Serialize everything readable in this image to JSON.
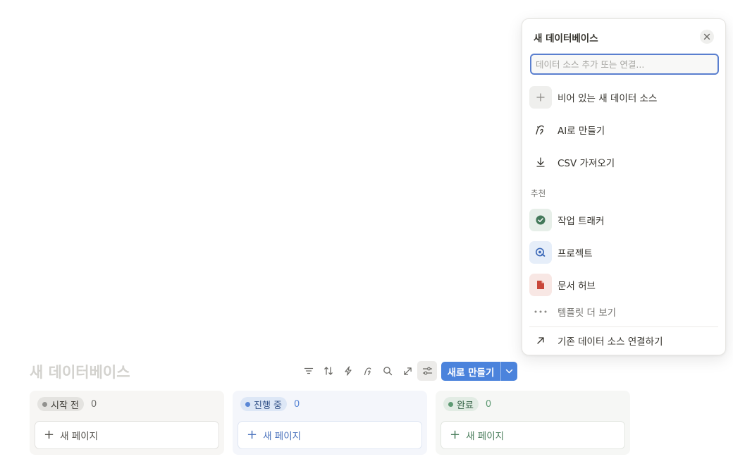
{
  "popup": {
    "title": "새 데이터베이스",
    "search_placeholder": "데이터 소스 추가 또는 연결...",
    "items": {
      "empty": "비어 있는 새 데이터 소스",
      "ai": "AI로 만들기",
      "csv": "CSV 가져오기"
    },
    "recommended_label": "추천",
    "templates": {
      "task": "작업 트래커",
      "project": "프로젝트",
      "docs": "문서 허브"
    },
    "more_templates": "템플릿 더 보기",
    "connect_existing": "기존 데이터 소스 연결하기"
  },
  "database": {
    "title": "새 데이터베이스",
    "new_button": "새로 만들기",
    "columns": [
      {
        "label": "시작 전",
        "count": "0",
        "new_page": "새 페이지"
      },
      {
        "label": "진행 중",
        "count": "0",
        "new_page": "새 페이지"
      },
      {
        "label": "완료",
        "count": "0",
        "new_page": "새 페이지"
      }
    ]
  },
  "icons": {
    "close": "close-icon",
    "plus": "plus-icon",
    "ai": "ai-sparkle-icon",
    "download": "download-icon",
    "check": "check-circle-icon",
    "target": "target-icon",
    "document": "document-icon",
    "ellipsis": "ellipsis-icon",
    "arrow": "arrow-up-right-icon",
    "filter": "filter-icon",
    "sort": "sort-icon",
    "automation": "lightning-icon",
    "search": "search-icon",
    "expand": "expand-icon",
    "settings": "sliders-icon",
    "chevron": "chevron-down-icon"
  },
  "colors": {
    "accent": "#4b83dc",
    "not_started": "#91918e",
    "in_progress": "#5a87d6",
    "done": "#5e9a73"
  }
}
